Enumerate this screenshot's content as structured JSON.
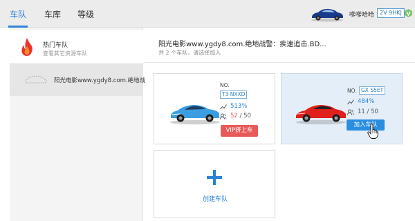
{
  "nav": {
    "tabs": [
      "车队",
      "车库",
      "等级"
    ],
    "active_tab": "车队",
    "username": "嗲嗲哈哈",
    "plate": "2V 9HKJ"
  },
  "sidebar": {
    "hot": {
      "title": "热门车队",
      "subtitle": "查看其它资源车队"
    },
    "team": {
      "title": "阳光电影www.ygdy8.com.绝地战"
    }
  },
  "main": {
    "title": "阳光电影www.ygdy8.com.绝地战警：疾速追击.BD...",
    "subtitle": "共 2 个车队，请选择加入",
    "cards": [
      {
        "no_label": "NO.",
        "plate": "T3 NXXD",
        "percent": "513%",
        "count_current": "52",
        "count_sep": " / ",
        "count_max": "50",
        "button": "VIP挤上车",
        "car_color": "#3a9ee0"
      },
      {
        "no_label": "NO.",
        "plate": "GX S5ET",
        "percent": "484%",
        "count_current": "11",
        "count_sep": " / ",
        "count_max": "50",
        "button": "加入车队",
        "car_color": "#e0201c"
      }
    ],
    "create_label": "创建车队"
  },
  "colors": {
    "accent": "#2a82d6",
    "vip_button": "#e85a58",
    "join_button": "#2a8ee0",
    "overflow_count": "#e35b5b"
  },
  "icons": [
    "fire-icon",
    "cloud-icon",
    "trend-icon",
    "people-icon",
    "plus-icon",
    "hand-cursor-icon",
    "vip-badge-icon"
  ]
}
